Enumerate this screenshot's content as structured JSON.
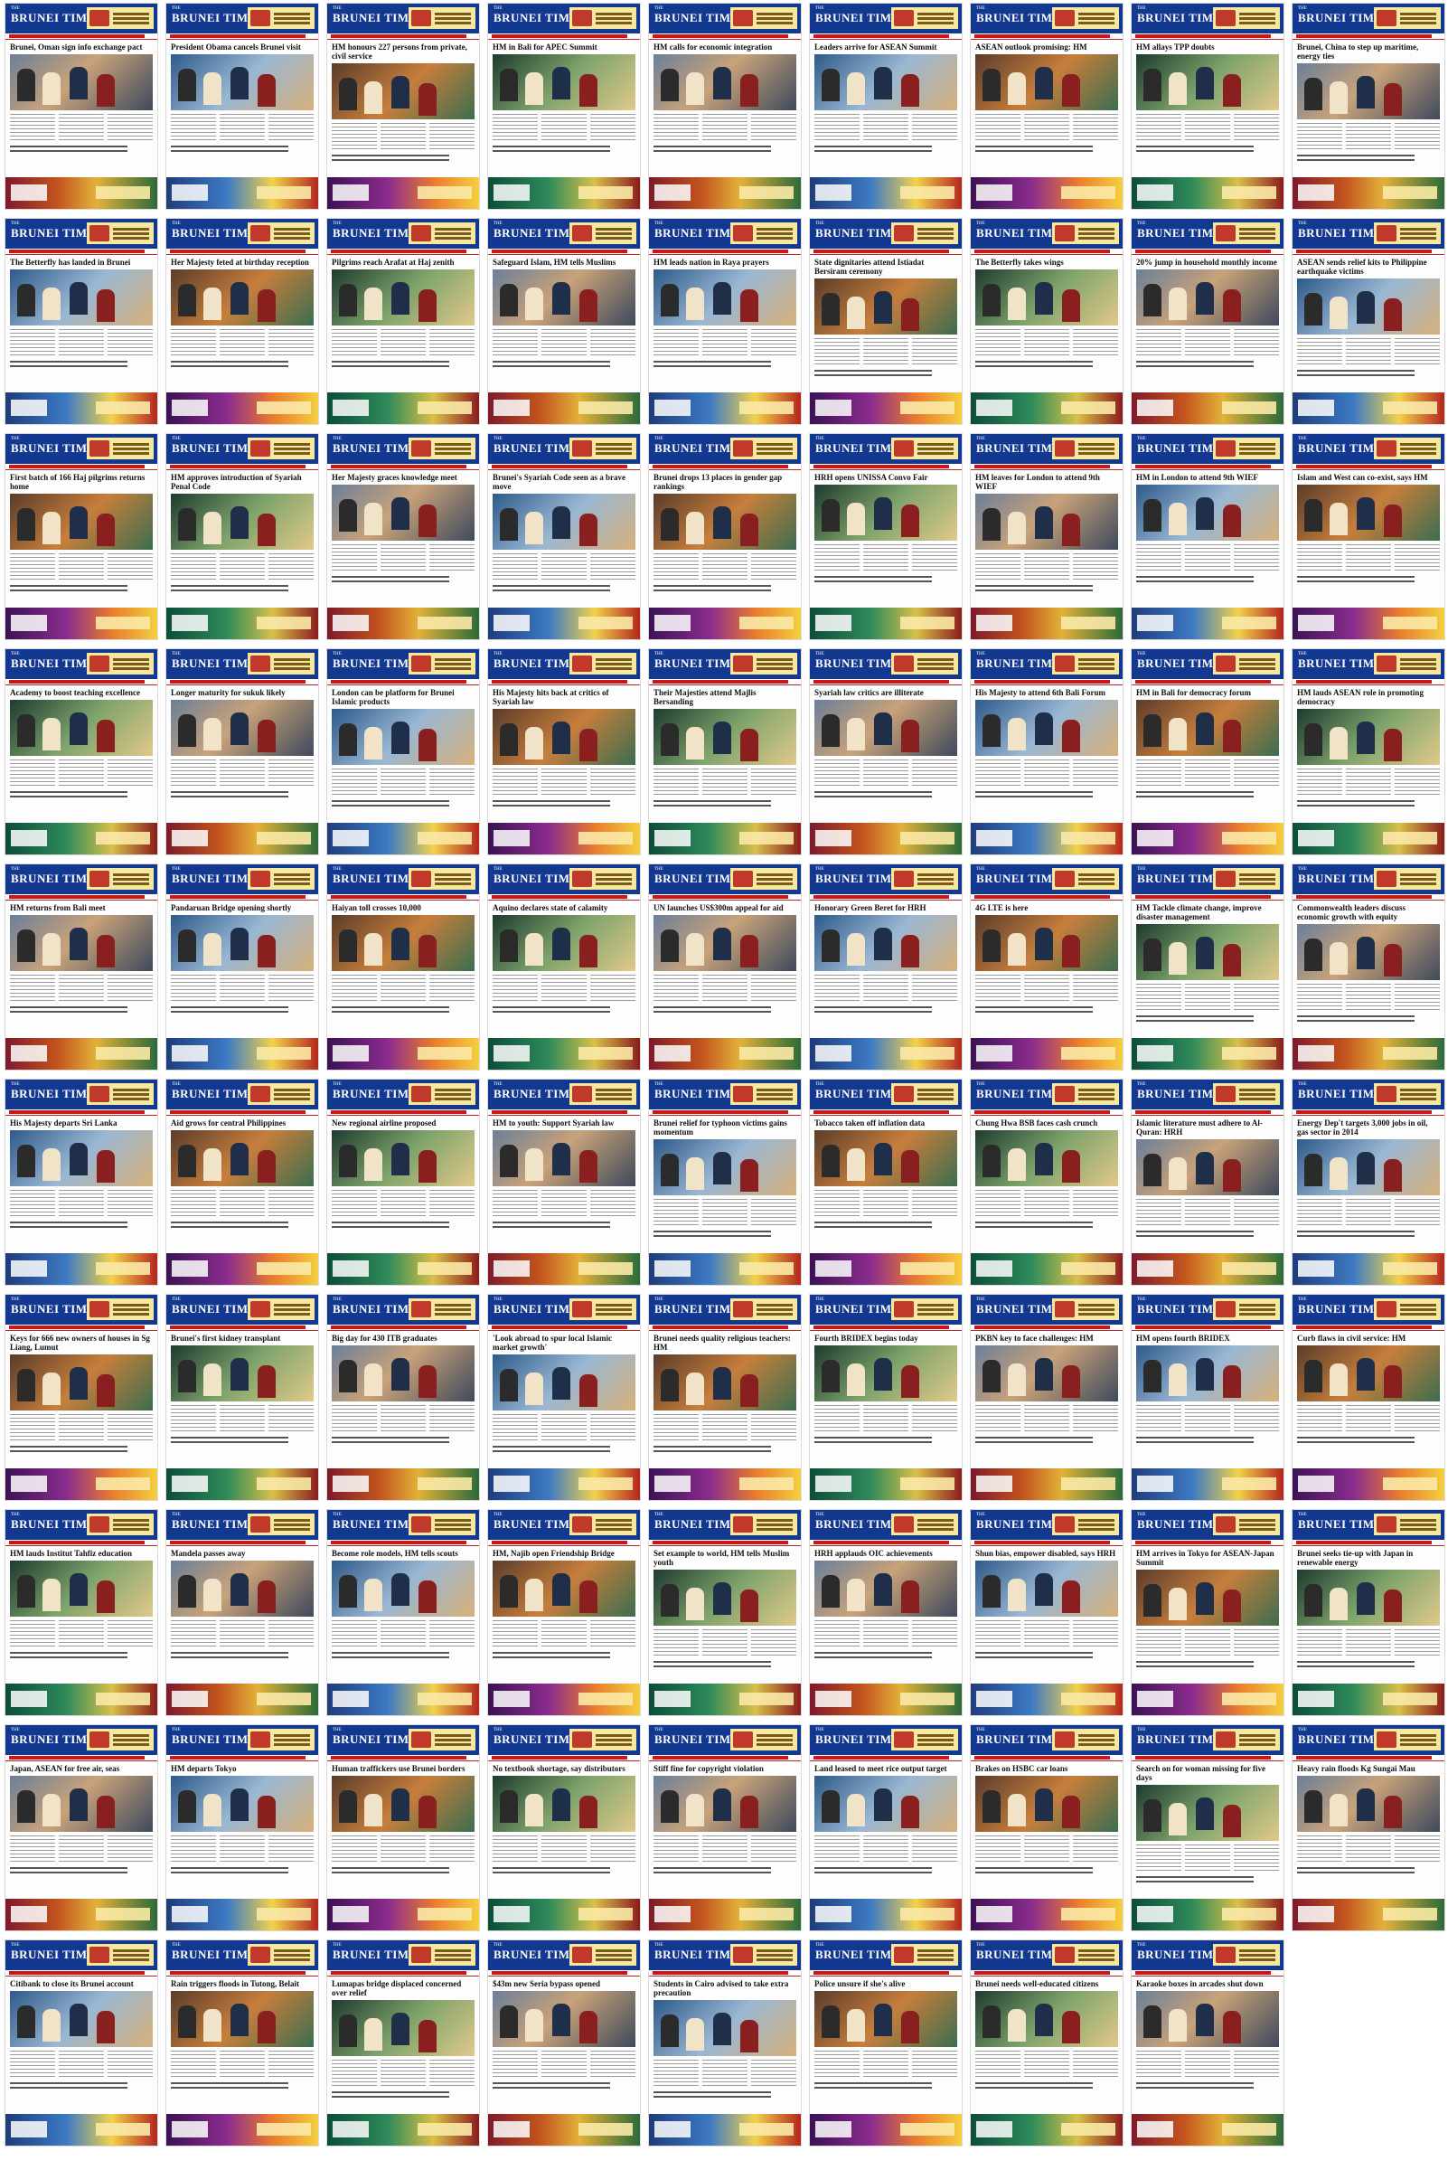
{
  "masthead": "BRUNEI TIMES",
  "masthead_small": "THE",
  "grid": {
    "columns": 9,
    "rows": 10
  },
  "pages": [
    "Brunei, Oman sign info exchange pact",
    "President Obama cancels Brunei visit",
    "HM honours 227 persons from private, civil service",
    "HM in Bali for APEC Summit",
    "HM calls for economic integration",
    "Leaders arrive for ASEAN Summit",
    "ASEAN outlook promising: HM",
    "HM allays TPP doubts",
    "Brunei, China to step up maritime, energy ties",
    "The Betterfly has landed in Brunei",
    "Her Majesty feted at birthday reception",
    "Pilgrims reach Arafat at Haj zenith",
    "Safeguard Islam, HM tells Muslims",
    "HM leads nation in Raya prayers",
    "State dignitaries attend Istiadat Bersiram ceremony",
    "The Betterfly takes wings",
    "20% jump in household monthly income",
    "ASEAN sends relief kits to Philippine earthquake victims",
    "First batch of 166 Haj pilgrims returns home",
    "HM approves introduction of Syariah Penal Code",
    "Her Majesty graces knowledge meet",
    "Brunei's Syariah Code seen as a brave move",
    "Brunei drops 13 places in gender gap rankings",
    "HRH opens UNISSA Convo Fair",
    "HM leaves for London to attend 9th WIEF",
    "HM in London to attend 9th WIEF",
    "Islam and West can co-exist, says HM",
    "Academy to boost teaching excellence",
    "Longer maturity for sukuk likely",
    "London can be platform for Brunei Islamic products",
    "His Majesty hits back at critics of Syariah law",
    "Their Majesties attend Majlis Bersanding",
    "Syariah law critics are illiterate",
    "His Majesty to attend 6th Bali Forum",
    "HM in Bali for democracy forum",
    "HM lauds ASEAN role in promoting democracy",
    "HM returns from Bali meet",
    "Pandaruan Bridge opening shortly",
    "Haiyan toll crosses 10,000",
    "Aquino declares state of calamity",
    "UN launches US$300m appeal for aid",
    "Honorary Green Beret for HRH",
    "4G LTE is here",
    "HM Tackle climate change, improve disaster management",
    "Commonwealth leaders discuss economic growth with equity",
    "His Majesty departs Sri Lanka",
    "Aid grows for central Philippines",
    "New regional airline proposed",
    "HM to youth: Support Syariah law",
    "Brunei relief for typhoon victims gains momentum",
    "Tobacco taken off inflation data",
    "Chung Hwa BSB faces cash crunch",
    "Islamic literature must adhere to Al-Quran: HRH",
    "Energy Dep't targets 3,000 jobs in oil, gas sector in 2014",
    "Keys for 666 new owners of houses in Sg Liang, Lumut",
    "Brunei's first kidney transplant",
    "Big day for 430 ITB graduates",
    "'Look abroad to spur local Islamic market growth'",
    "Brunei needs quality religious teachers: HM",
    "Fourth BRIDEX begins today",
    "PKBN key to face challenges: HM",
    "HM opens fourth BRIDEX",
    "Curb flaws in civil service: HM",
    "HM lauds Institut Tahfiz education",
    "Mandela passes away",
    "Become role models, HM tells scouts",
    "HM, Najib open Friendship Bridge",
    "Set example to world, HM tells Muslim youth",
    "HRH applauds OIC achievements",
    "Shun bias, empower disabled, says HRH",
    "HM arrives in Tokyo for ASEAN-Japan Summit",
    "Brunei seeks tie-up with Japan in renewable energy",
    "Japan, ASEAN for free air, seas",
    "HM departs Tokyo",
    "Human traffickers use Brunei borders",
    "No textbook shortage, say distributors",
    "Stiff fine for copyright violation",
    "Land leased to meet rice output target",
    "Brakes on HSBC car loans",
    "Search on for woman missing for five days",
    "Heavy rain floods Kg Sungai Mau",
    "Citibank to close its Brunei account",
    "Rain triggers floods in Tutong, Belait",
    "Lumapas bridge displaced concerned over relief",
    "$43m new Seria bypass opened",
    "Students in Cairo advised to take extra precaution",
    "Police unsure if she's alive",
    "Brunei needs well-educated citizens",
    "Karaoke boxes in arcades shut down"
  ]
}
